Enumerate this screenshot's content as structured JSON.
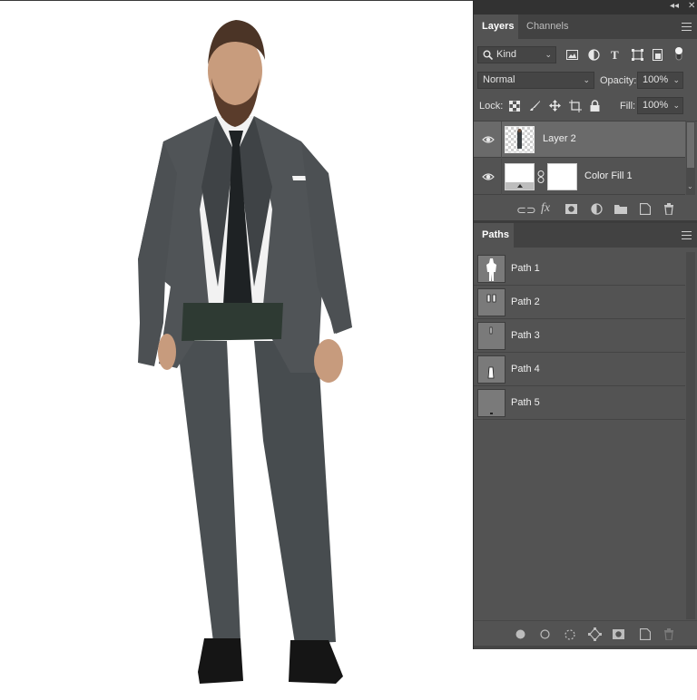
{
  "window": {
    "collapse_glyph": "◂◂",
    "close_glyph": "✕"
  },
  "layers_panel": {
    "tabs": [
      {
        "label": "Layers",
        "active": true
      },
      {
        "label": "Channels",
        "active": false
      }
    ],
    "filter": {
      "label": "Kind"
    },
    "filter_icons": [
      "image-filter-icon",
      "adjustment-filter-icon",
      "type-filter-icon",
      "shape-filter-icon",
      "smart-object-filter-icon"
    ],
    "blend_mode": "Normal",
    "opacity_label": "Opacity:",
    "opacity_value": "100%",
    "lock_label": "Lock:",
    "lock_icons": [
      "lock-transparent-icon",
      "lock-image-icon",
      "lock-position-icon",
      "lock-artboard-icon",
      "lock-all-icon"
    ],
    "fill_label": "Fill:",
    "fill_value": "100%",
    "layers": [
      {
        "name": "Layer 2",
        "visible": true,
        "selected": true
      },
      {
        "name": "Color Fill 1",
        "visible": true,
        "selected": false
      }
    ],
    "footer_icons": [
      "link-icon",
      "fx-icon",
      "mask-icon",
      "adjustment-icon",
      "group-icon",
      "new-layer-icon",
      "trash-icon"
    ],
    "fx_label": "fx"
  },
  "paths_panel": {
    "tab": "Paths",
    "paths": [
      {
        "name": "Path 1"
      },
      {
        "name": "Path 2"
      },
      {
        "name": "Path 3"
      },
      {
        "name": "Path 4"
      },
      {
        "name": "Path 5"
      }
    ],
    "footer_icons": [
      "fill-path-icon",
      "stroke-path-icon",
      "load-selection-icon",
      "make-work-path-icon",
      "add-mask-icon",
      "new-path-icon",
      "trash-icon"
    ]
  },
  "colors": {
    "panel_bg": "#535353",
    "tab_bar_bg": "#424242",
    "selected_row": "#6a6a6a",
    "suit": "#4a4f52",
    "shirt": "#f2f2f2",
    "tie": "#1e2224",
    "waistband": "#2e3a33"
  }
}
